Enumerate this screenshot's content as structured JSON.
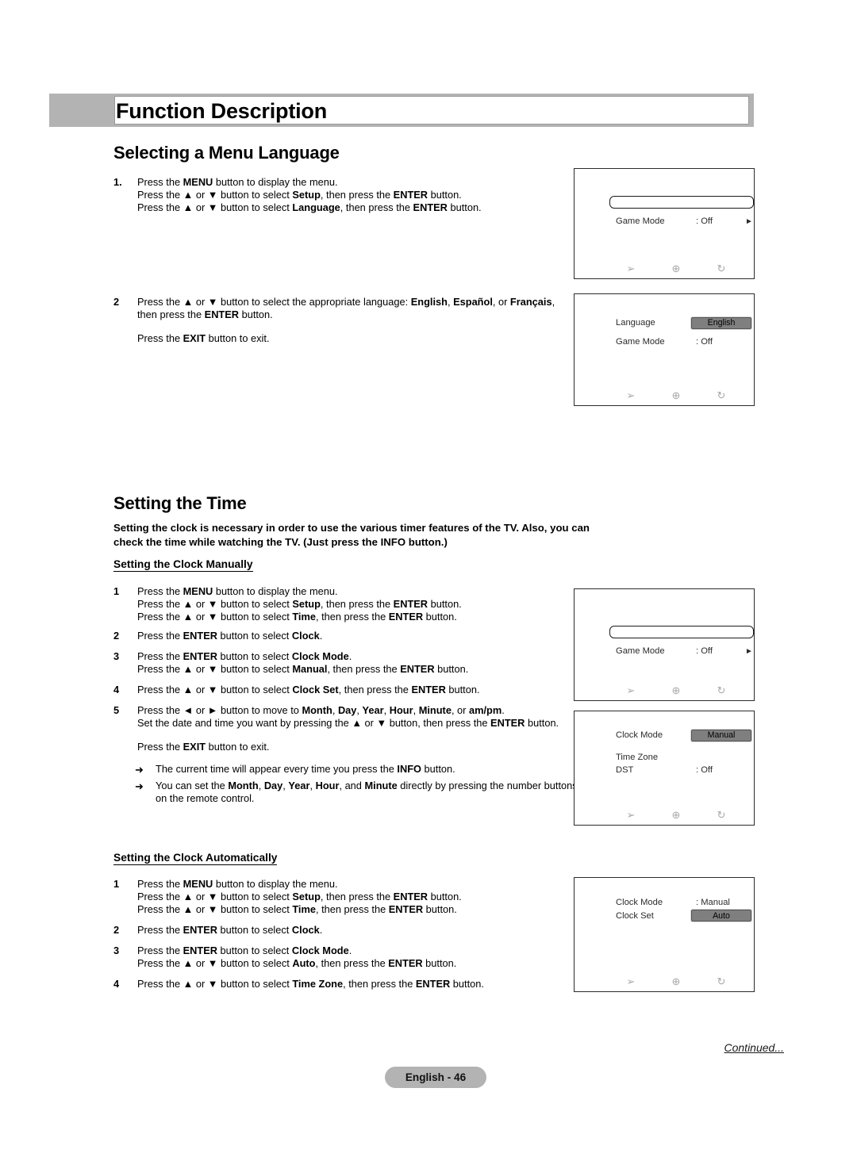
{
  "header": {
    "chapter_title": "Function Description"
  },
  "sections": {
    "language": {
      "title": "Selecting a Menu Language",
      "steps": [
        {
          "num": "1.",
          "lines": [
            "Press the <b>MENU</b> button to display the menu.",
            "Press the ▲ or ▼ button to select <b>Setup</b>, then press the <b>ENTER</b> button.",
            "Press the ▲ or ▼ button to select <b>Language</b>, then press the <b>ENTER</b> button."
          ]
        },
        {
          "num": "2",
          "lines": [
            "Press the ▲ or ▼ button to select the appropriate language: <b>English</b>, <b>Español</b>, or <b>Français</b>, then press the <b>ENTER</b> button."
          ],
          "extra": "Press the <b>EXIT</b> button to exit."
        }
      ]
    },
    "time": {
      "title": "Setting the Time",
      "intro": "Setting the clock is necessary in order to use the various timer features of the TV. Also, you can check the time while watching the TV. (Just press the INFO button.)",
      "manual": {
        "subtitle": "Setting the Clock Manually",
        "steps": [
          {
            "num": "1",
            "lines": [
              "Press the <b>MENU</b> button to display the menu.",
              "Press the ▲ or ▼ button to select <b>Setup</b>, then press the <b>ENTER</b> button.",
              "Press the ▲ or ▼ button to select <b>Time</b>, then press the <b>ENTER</b> button."
            ]
          },
          {
            "num": "2",
            "lines": [
              "Press the <b>ENTER</b> button to select <b>Clock</b>."
            ]
          },
          {
            "num": "3",
            "lines": [
              "Press the <b>ENTER</b> button to select <b>Clock Mode</b>.",
              "Press the ▲ or ▼ button to select <b>Manual</b>, then press the <b>ENTER</b> button."
            ]
          },
          {
            "num": "4",
            "lines": [
              "Press the ▲ or ▼ button to select <b>Clock Set</b>, then press the <b>ENTER</b> button."
            ]
          },
          {
            "num": "5",
            "lines": [
              "Press the ◄ or ► button to  move to <b>Month</b>, <b>Day</b>, <b>Year</b>, <b>Hour</b>, <b>Minute</b>, or <b>am/pm</b>.",
              "Set the date and time you want by pressing the ▲ or ▼ button, then press the <b>ENTER</b> button."
            ],
            "extra": "Press the <b>EXIT</b> button to exit."
          }
        ],
        "notes": [
          "The current time will appear every time you press the <b>INFO</b> button.",
          "You can set the <b>Month</b>, <b>Day</b>, <b>Year</b>, <b>Hour</b>, and <b>Minute</b> directly by pressing the number buttons on the remote control."
        ]
      },
      "automatic": {
        "subtitle": "Setting the Clock Automatically",
        "steps": [
          {
            "num": "1",
            "lines": [
              "Press the <b>MENU</b> button to display the menu.",
              "Press the ▲ or ▼ button to select <b>Setup</b>, then press the <b>ENTER</b> button.",
              "Press the ▲ or ▼ button to select <b>Time</b>, then press the <b>ENTER</b> button."
            ]
          },
          {
            "num": "2",
            "lines": [
              "Press the <b>ENTER</b> button to select <b>Clock</b>."
            ]
          },
          {
            "num": "3",
            "lines": [
              "Press the <b>ENTER</b> button to select <b>Clock Mode</b>.",
              "Press the ▲ or ▼ button to select <b>Auto</b>, then press the <b>ENTER</b> button."
            ]
          },
          {
            "num": "4",
            "lines": [
              "Press the ▲ or ▼ button to select <b>Time Zone</b>, then press the <b>ENTER</b> button."
            ]
          }
        ]
      }
    }
  },
  "osd_screens": [
    {
      "id": "setup-menu-empty",
      "rows": [
        {
          "type": "empty-bar"
        },
        {
          "type": "value",
          "label": "Game Mode",
          "value": ": Off",
          "arrow": "►"
        }
      ],
      "footer_icons": [
        "move-icon",
        "enter-icon",
        "return-icon"
      ]
    },
    {
      "id": "language-select",
      "rows": [
        {
          "type": "badge",
          "label": "Language",
          "badge": "English"
        },
        {
          "type": "value",
          "label": "Game Mode",
          "value": ": Off"
        }
      ],
      "footer_icons": [
        "move-icon",
        "enter-icon",
        "return-icon"
      ]
    },
    {
      "id": "time-menu-empty",
      "rows": [
        {
          "type": "empty-bar"
        },
        {
          "type": "value",
          "label": "Game Mode",
          "value": ": Off",
          "arrow": "►"
        }
      ],
      "footer_icons": [
        "move-icon",
        "enter-icon",
        "return-icon"
      ]
    },
    {
      "id": "clock-mode-manual",
      "rows": [
        {
          "type": "badge",
          "label": "Clock Mode",
          "badge": "Manual"
        },
        {
          "type": "value",
          "label": "Time Zone",
          "value": ""
        },
        {
          "type": "value",
          "label": "DST",
          "value": ": Off"
        }
      ],
      "footer_icons": [
        "move-icon",
        "enter-icon",
        "return-icon"
      ]
    },
    {
      "id": "clock-set-auto",
      "rows": [
        {
          "type": "value",
          "label": "Clock Mode",
          "value": ": Manual"
        },
        {
          "type": "badge",
          "label": "Clock Set",
          "badge": "Auto"
        }
      ],
      "footer_icons": [
        "move-icon",
        "enter-icon",
        "return-icon"
      ]
    }
  ],
  "footer": {
    "continued": "Continued...",
    "page_label": "English - 46"
  },
  "colors": {
    "header_gray": "#b3b3b3",
    "badge_gray": "#7f7f7f",
    "osd_border": "#2b2b2b",
    "icon_gray": "#a8a8a8"
  }
}
